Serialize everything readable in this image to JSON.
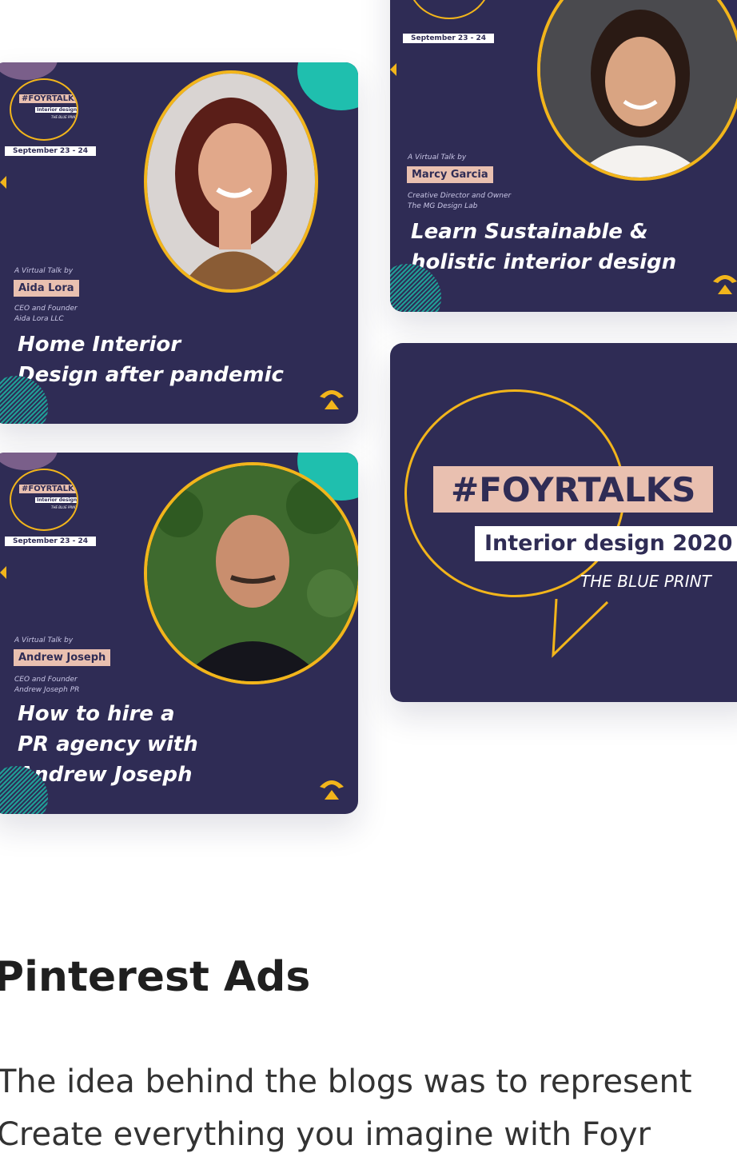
{
  "event": {
    "hashtag": "#FOYRTALKS",
    "subtitle": "Interior design 2020",
    "tagline": "THE BLUE PRINT",
    "dates": "September 23 - 24",
    "virtual_label": "A Virtual Talk by"
  },
  "cards": [
    {
      "speaker": "Aida Lora",
      "role_line1": "CEO and Founder",
      "role_line2": "Aida Lora LLC",
      "talk_line1": "Home Interior",
      "talk_line2": "Design after pandemic",
      "talk_line3": ""
    },
    {
      "speaker": "Marcy Garcia",
      "role_line1": "Creative Director and Owner",
      "role_line2": "The MG Design Lab",
      "talk_line1": "Learn Sustainable &",
      "talk_line2": "holistic interior design",
      "talk_line3": ""
    },
    {
      "speaker": "Andrew Joseph",
      "role_line1": "CEO and Founder",
      "role_line2": "Andrew Joseph PR",
      "talk_line1": "How to hire a",
      "talk_line2": "PR agency with",
      "talk_line3": "Andrew Joseph"
    }
  ],
  "section": {
    "heading": "Pinterest Ads",
    "line1": "The idea behind the blogs was to represent",
    "line2": "Create everything you imagine with Foyr"
  },
  "colors": {
    "card_bg": "#2f2c55",
    "accent_yellow": "#f2b51b",
    "peach": "#e9c0b0",
    "teal": "#1fbfae"
  }
}
